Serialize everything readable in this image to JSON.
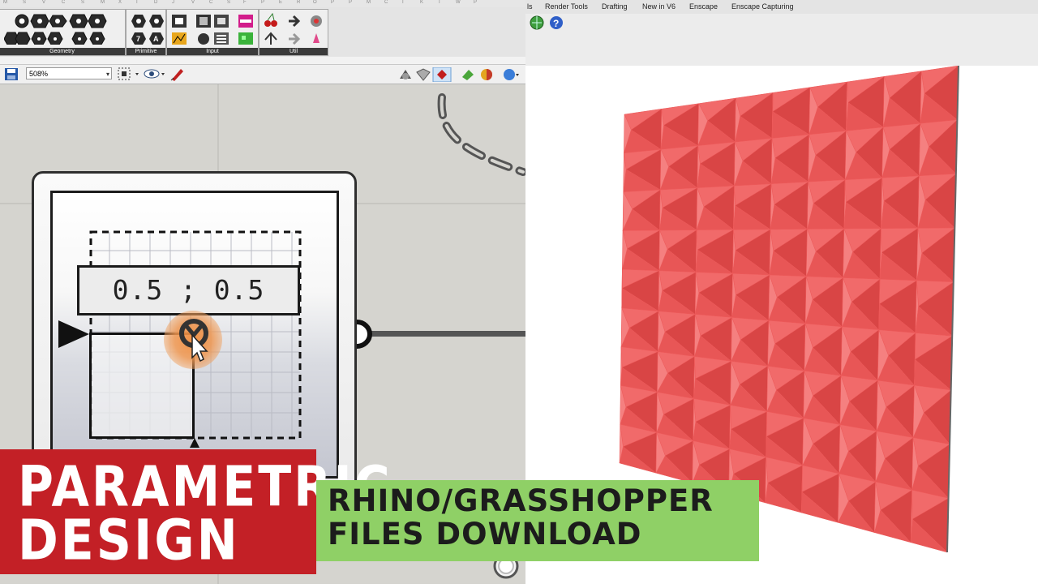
{
  "ruler_letters": [
    "M",
    "S",
    "V",
    "C",
    "S",
    "M",
    "X",
    "I",
    "D",
    "J",
    "V",
    "C",
    "S",
    "F",
    "P",
    "E",
    "R",
    "O",
    "P",
    "P",
    "M",
    "C",
    "I",
    "K",
    "T",
    "W",
    "P"
  ],
  "ribbon": {
    "groups": [
      {
        "label": "Geometry"
      },
      {
        "label": "Primitive"
      },
      {
        "label": "Input"
      },
      {
        "label": "Util"
      }
    ]
  },
  "toolbar": {
    "zoom_value": "508%"
  },
  "component": {
    "value_text": "0.5 ; 0.5"
  },
  "rhino": {
    "tabs": [
      "ls",
      "Render Tools",
      "Drafting",
      "New in V6",
      "Enscape",
      "Enscape Capturing"
    ]
  },
  "banner": {
    "line1": "PARAMETRIC",
    "line2": "DESIGN",
    "sub1": "RHINO/GRASSHOPPER",
    "sub2": "FILES DOWNLOAD"
  },
  "colors": {
    "banner_red": "#c32026",
    "banner_green": "#8fd066",
    "wall_red": "#ee5a5a",
    "cursor_orange": "#f08c3c"
  }
}
